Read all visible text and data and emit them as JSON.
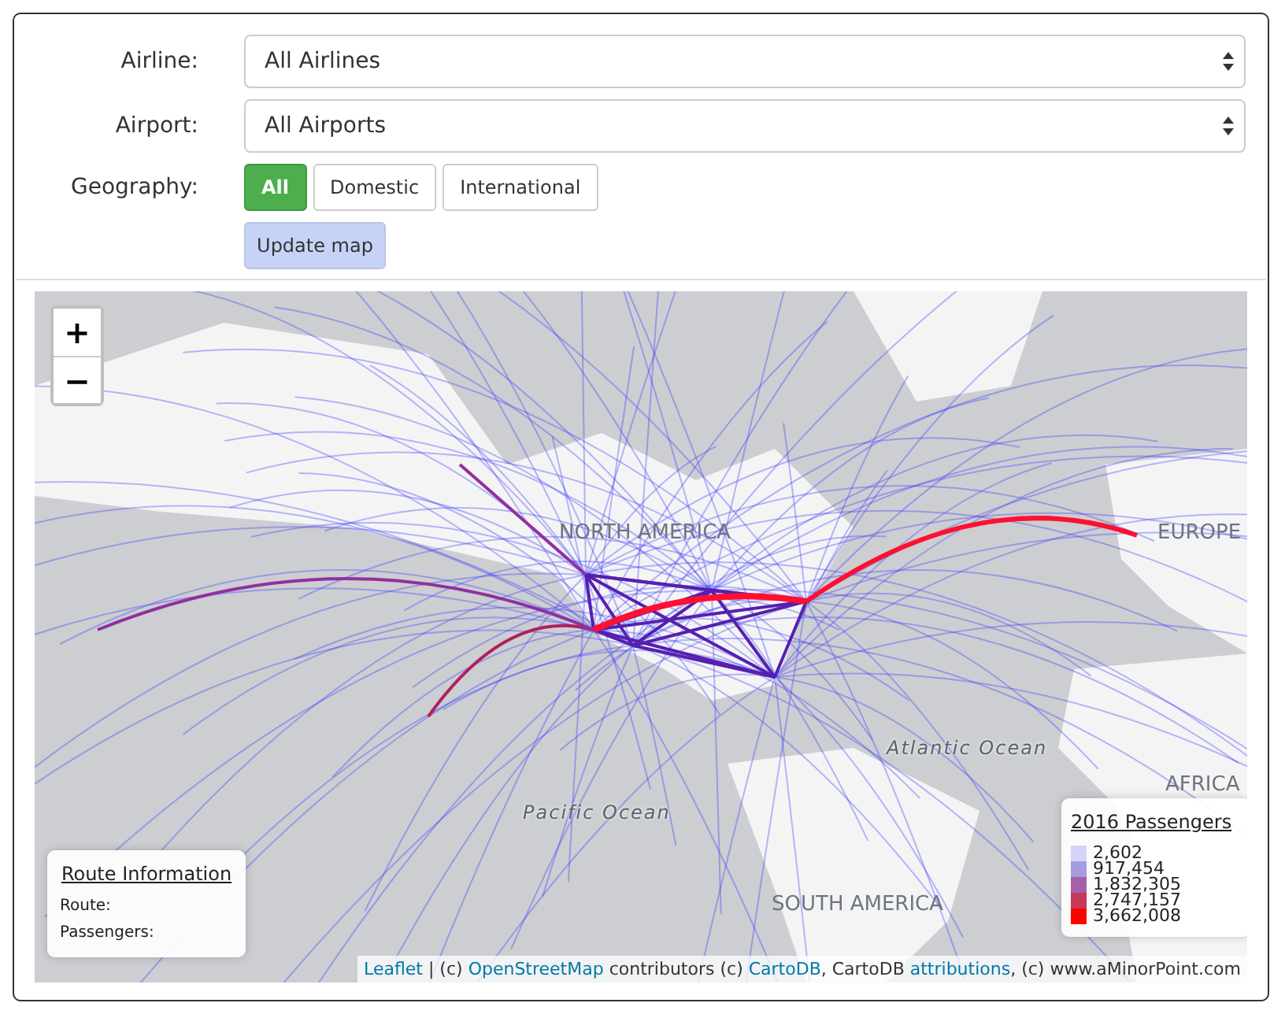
{
  "filters": [
    {
      "label": "Airline:",
      "value": "All Airlines"
    },
    {
      "label": "Airport:",
      "value": "All Airports"
    }
  ],
  "geography": {
    "label": "Geography:",
    "options": [
      {
        "label": "All",
        "selected": true
      },
      {
        "label": "Domestic",
        "selected": false
      },
      {
        "label": "International",
        "selected": false
      }
    ]
  },
  "update_button": "Update map",
  "map": {
    "zoom_in": "+",
    "zoom_out": "−",
    "labels": [
      {
        "text": "NORTH AMERICA",
        "kind": "region"
      },
      {
        "text": "EUROPE",
        "kind": "region"
      },
      {
        "text": "AFRICA",
        "kind": "region"
      },
      {
        "text": "Atlantic Ocean",
        "kind": "ocean"
      },
      {
        "text": "Pacific Ocean",
        "kind": "ocean"
      },
      {
        "text": "SOUTH AMERICA",
        "kind": "region"
      }
    ],
    "route_info": {
      "title": "Route Information",
      "fields": [
        "Route:",
        "Passengers:"
      ]
    },
    "legend": {
      "title": "2016 Passengers",
      "items": [
        {
          "label": "2,602",
          "color": "#d4d4f7"
        },
        {
          "label": "917,454",
          "color": "#a99be0"
        },
        {
          "label": "1,832,305",
          "color": "#a660a8"
        },
        {
          "label": "2,747,157",
          "color": "#c53a5a"
        },
        {
          "label": "3,662,008",
          "color": "#ff0000"
        }
      ]
    },
    "attribution": [
      {
        "kind": "link",
        "text": "Leaflet"
      },
      {
        "kind": "text",
        "text": " | (c) "
      },
      {
        "kind": "link",
        "text": "OpenStreetMap"
      },
      {
        "kind": "text",
        "text": " contributors (c) "
      },
      {
        "kind": "link",
        "text": "CartoDB"
      },
      {
        "kind": "text",
        "text": ", CartoDB "
      },
      {
        "kind": "link",
        "text": "attributions"
      },
      {
        "kind": "text",
        "text": ", (c) www.aMinorPoint.com"
      }
    ]
  }
}
